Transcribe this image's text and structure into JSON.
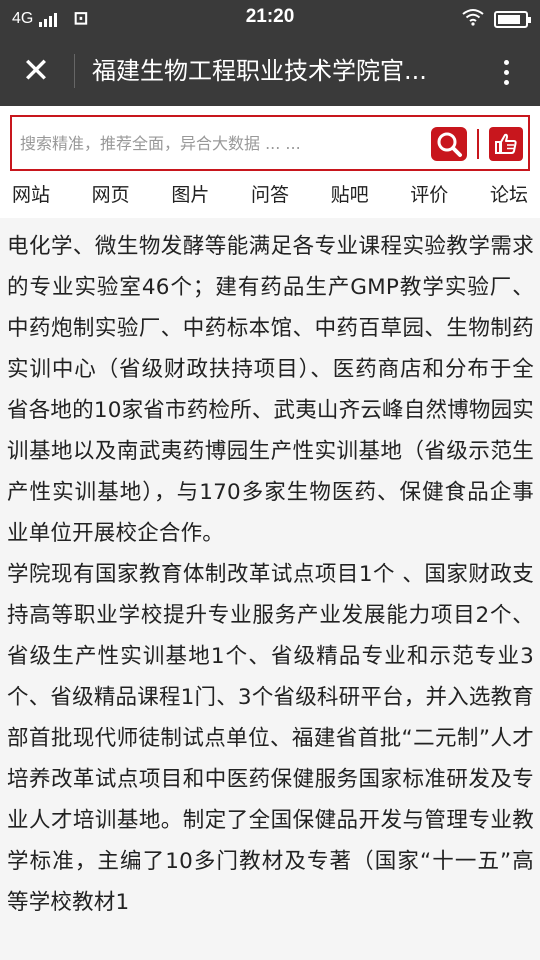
{
  "status_bar": {
    "network": "4G",
    "time": "21:20",
    "sim_icon": "sim-card-icon",
    "wifi_icon": "wifi-icon",
    "battery_level": 0.85
  },
  "title_bar": {
    "close_icon": "close-icon",
    "title": "福建生物工程职业技术学院官...",
    "more_icon": "more-vertical-icon"
  },
  "search": {
    "placeholder": "搜索精准，推荐全面，异合大数据 ... ...",
    "search_icon": "search-icon",
    "like_icon": "thumbs-up-icon",
    "accent": "#c8161d"
  },
  "nav_tabs": [
    "网站",
    "网页",
    "图片",
    "问答",
    "贴吧",
    "评价",
    "论坛"
  ],
  "content": {
    "paragraphs": [
      "电化学、微生物发酵等能满足各专业课程实验教学需求的专业实验室46个；建有药品生产GMP教学实验厂、中药炮制实验厂、中药标本馆、中药百草园、生物制药实训中心（省级财政扶持项目）、医药商店和分布于全省各地的10家省市药检所、武夷山齐云峰自然博物园实训基地以及南武夷药博园生产性实训基地（省级示范生产性实训基地），与170多家生物医药、保健食品企事业单位开展校企合作。",
      "学院现有国家教育体制改革试点项目1个 、国家财政支持高等职业学校提升专业服务产业发展能力项目2个、省级生产性实训基地1个、省级精品专业和示范专业3个、省级精品课程1门、3个省级科研平台，并入选教育部首批现代师徒制试点单位、福建省首批“二元制”人才培养改革试点项目和中医药保健服务国家标准研发及专业人才培训基地。制定了全国保健品开发与管理专业教学标准，主编了10多门教材及专著（国家“十一五”高等学校教材1"
    ]
  }
}
